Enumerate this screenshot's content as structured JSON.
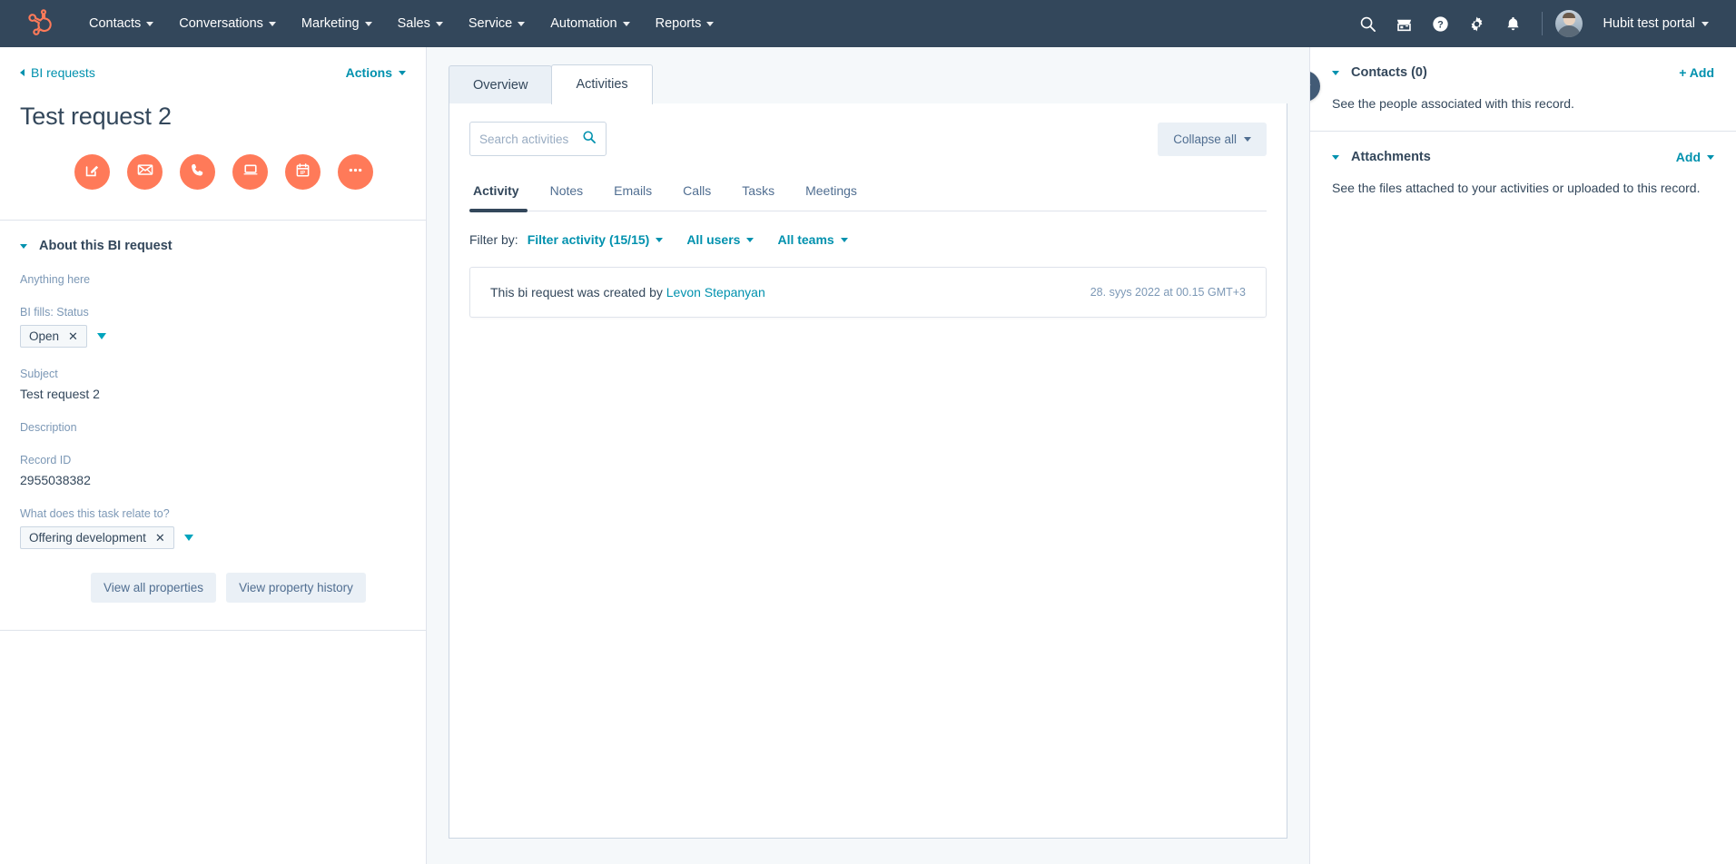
{
  "topnav": {
    "logo": "hubspot-sprocket-logo",
    "items": [
      {
        "label": "Contacts"
      },
      {
        "label": "Conversations"
      },
      {
        "label": "Marketing"
      },
      {
        "label": "Sales"
      },
      {
        "label": "Service"
      },
      {
        "label": "Automation"
      },
      {
        "label": "Reports"
      }
    ],
    "icons": [
      {
        "name": "search-icon"
      },
      {
        "name": "marketplace-icon"
      },
      {
        "name": "help-icon"
      },
      {
        "name": "settings-gear-icon"
      },
      {
        "name": "notifications-bell-icon"
      }
    ],
    "portal_name": "Hubit test portal",
    "background_color": "#33475b"
  },
  "left_panel": {
    "breadcrumb": "BI requests",
    "actions_label": "Actions",
    "record_title": "Test request 2",
    "quick_actions": [
      {
        "name": "note-action",
        "icon": "note-pencil-icon"
      },
      {
        "name": "email-action",
        "icon": "envelope-icon"
      },
      {
        "name": "call-action",
        "icon": "phone-icon"
      },
      {
        "name": "log-action",
        "icon": "laptop-icon"
      },
      {
        "name": "meeting-action",
        "icon": "calendar-icon"
      },
      {
        "name": "more-action",
        "icon": "ellipsis-icon"
      }
    ],
    "accent_color": "#ff7a59",
    "about": {
      "section_title": "About this BI request",
      "fields": [
        {
          "label": "Anything here",
          "value": "",
          "type": "text"
        },
        {
          "label": "BI fills: Status",
          "value": "Open",
          "type": "tag"
        },
        {
          "label": "Subject",
          "value": "Test request 2",
          "type": "text"
        },
        {
          "label": "Description",
          "value": "",
          "type": "text"
        },
        {
          "label": "Record ID",
          "value": "2955038382",
          "type": "text"
        },
        {
          "label": "What does this task relate to?",
          "value": "Offering development",
          "type": "tag"
        }
      ],
      "buttons": [
        {
          "label": "View all properties"
        },
        {
          "label": "View property history"
        }
      ]
    }
  },
  "center_panel": {
    "tabs": [
      {
        "label": "Overview",
        "active": false
      },
      {
        "label": "Activities",
        "active": true
      }
    ],
    "search_placeholder": "Search activities",
    "search_value": "",
    "collapse_all_label": "Collapse all",
    "subtabs": [
      {
        "label": "Activity",
        "active": true
      },
      {
        "label": "Notes",
        "active": false
      },
      {
        "label": "Emails",
        "active": false
      },
      {
        "label": "Calls",
        "active": false
      },
      {
        "label": "Tasks",
        "active": false
      },
      {
        "label": "Meetings",
        "active": false
      }
    ],
    "filter": {
      "label": "Filter by:",
      "activity_filter": "Filter activity (15/15)",
      "users_filter": "All users",
      "teams_filter": "All teams"
    },
    "activities": [
      {
        "text_before": "This bi request was created by ",
        "link_text": "Levon Stepanyan",
        "timestamp": "28. syys 2022 at 00.15 GMT+3"
      }
    ]
  },
  "right_panel": {
    "collapse_icon": "double-chevron-right-icon",
    "sections": [
      {
        "title": "Contacts (0)",
        "action": "+ Add",
        "action_has_caret": false,
        "description": "See the people associated with this record."
      },
      {
        "title": "Attachments",
        "action": "Add",
        "action_has_caret": true,
        "description": "See the files attached to your activities or uploaded to this record."
      }
    ]
  }
}
